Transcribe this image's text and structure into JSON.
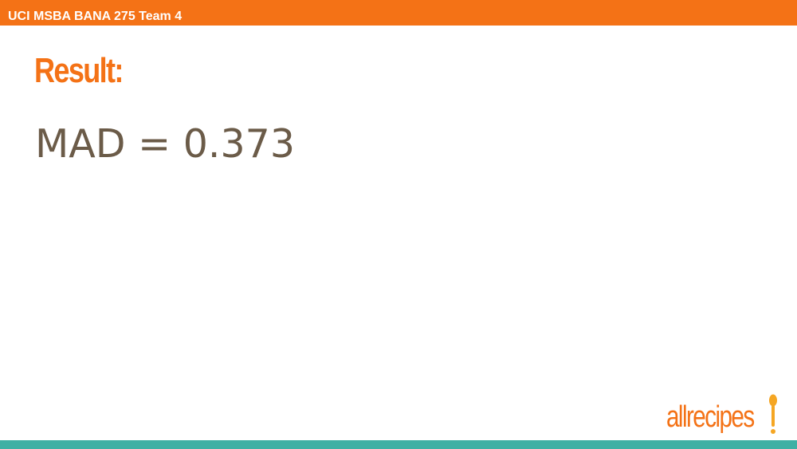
{
  "header": {
    "text": "UCI MSBA BANA 275 Team 4"
  },
  "slide": {
    "title": "Result:",
    "body": "MAD = 0.373"
  },
  "logo": {
    "text": "allrecipes"
  },
  "colors": {
    "accent": "#f47216",
    "body_text": "#6b5b48",
    "footer_bar": "#3fb0a4",
    "spoon": "#f5a623"
  },
  "icons": {
    "logo_mark": "spoon-icon"
  }
}
